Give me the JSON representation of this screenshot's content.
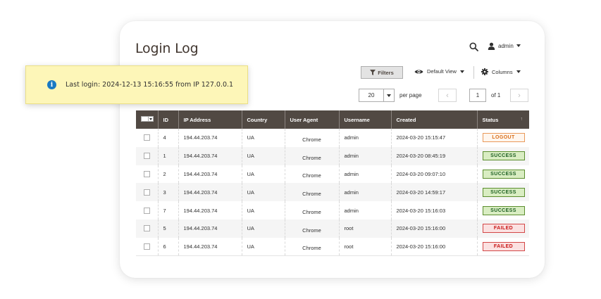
{
  "page": {
    "title": "Login Log",
    "user_name": "admin"
  },
  "notice": {
    "text": "Last login: 2024-12-13 15:16:55 from IP 127.0.0.1"
  },
  "toolbar": {
    "filters_label": "Filters",
    "view_label": "Default View",
    "columns_label": "Columns",
    "per_page_value": "20",
    "per_page_label": "per page",
    "current_page": "1",
    "page_total": "of 1"
  },
  "grid": {
    "columns": [
      "ID",
      "IP Address",
      "Country",
      "User Agent",
      "Username",
      "Created",
      "Status"
    ],
    "rows": [
      {
        "id": "4",
        "ip": "194.44.203.74",
        "country": "UA",
        "agent": "Chrome",
        "username": "admin",
        "created": "2024-03-20 15:15:47",
        "status": "LOGOUT",
        "status_type": "logout"
      },
      {
        "id": "1",
        "ip": "194.44.203.74",
        "country": "UA",
        "agent": "Chrome",
        "username": "admin",
        "created": "2024-03-20 08:45:19",
        "status": "SUCCESS",
        "status_type": "success"
      },
      {
        "id": "2",
        "ip": "194.44.203.74",
        "country": "UA",
        "agent": "Chrome",
        "username": "admin",
        "created": "2024-03-20 09:07:10",
        "status": "SUCCESS",
        "status_type": "success"
      },
      {
        "id": "3",
        "ip": "194.44.203.74",
        "country": "UA",
        "agent": "Chrome",
        "username": "admin",
        "created": "2024-03-20 14:59:17",
        "status": "SUCCESS",
        "status_type": "success"
      },
      {
        "id": "7",
        "ip": "194.44.203.74",
        "country": "UA",
        "agent": "Chrome",
        "username": "admin",
        "created": "2024-03-20 15:16:03",
        "status": "SUCCESS",
        "status_type": "success"
      },
      {
        "id": "5",
        "ip": "194.44.203.74",
        "country": "UA",
        "agent": "Chrome",
        "username": "root",
        "created": "2024-03-20 15:16:00",
        "status": "FAILED",
        "status_type": "failed"
      },
      {
        "id": "6",
        "ip": "194.44.203.74",
        "country": "UA",
        "agent": "Chrome",
        "username": "root",
        "created": "2024-03-20 15:16:00",
        "status": "FAILED",
        "status_type": "failed"
      }
    ]
  },
  "colors": {
    "header_bg": "#514943",
    "notice_bg": "#fdf6b8",
    "info_blue": "#1979c3",
    "success": "#5b8e2e",
    "failed": "#d34747",
    "logout": "#e99a5b"
  }
}
